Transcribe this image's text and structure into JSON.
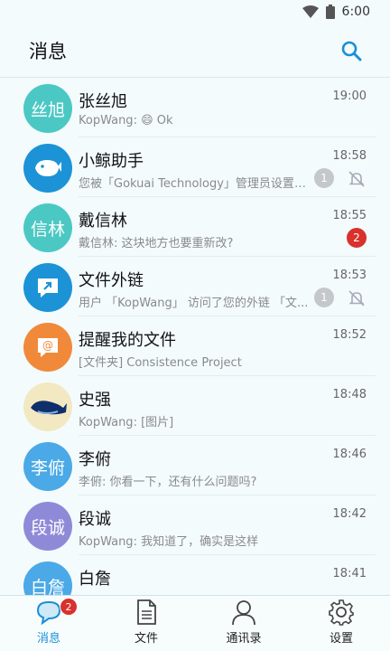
{
  "status_bar": {
    "time": "6:00"
  },
  "header": {
    "title": "消息"
  },
  "conversations": [
    {
      "avatar_text": "丝旭",
      "avatar_color": "#4cc8c4",
      "name": "张丝旭",
      "time": "19:00",
      "preview": "KopWang: 😄 Ok"
    },
    {
      "avatar_icon": "whale-icon",
      "avatar_color": "#1c93d6",
      "name": "小鲸助手",
      "time": "18:58",
      "preview": "您被「Gokuai Technology」管理员设置为...",
      "unread": "1",
      "muted": true
    },
    {
      "avatar_text": "信林",
      "avatar_color": "#4cc8c4",
      "name": "戴信林",
      "time": "18:55",
      "preview": "戴信林: 这块地方也要重新改?",
      "badge": "2"
    },
    {
      "avatar_icon": "link-icon",
      "avatar_color": "#1c93d6",
      "name": "文件外链",
      "time": "18:53",
      "preview": "用户 「KopWang」 访问了您的外链 「文...",
      "unread": "1",
      "muted": true
    },
    {
      "avatar_icon": "mention-icon",
      "avatar_color": "#f08a3a",
      "name": "提醒我的文件",
      "time": "18:52",
      "preview": "[文件夹] Consistence Project"
    },
    {
      "avatar_icon": "whale-photo-icon",
      "avatar_color": "#f2e9c2",
      "name": "史强",
      "time": "18:48",
      "preview": "KopWang: [图片]"
    },
    {
      "avatar_text": "李俯",
      "avatar_color": "#4aa9e6",
      "name": "李俯",
      "time": "18:46",
      "preview": "李俯: 你看一下，还有什么问题吗?"
    },
    {
      "avatar_text": "段诚",
      "avatar_color": "#8f8ad8",
      "name": "段诚",
      "time": "18:42",
      "preview": "KopWang: 我知道了，确实是这样"
    },
    {
      "avatar_text": "白詹",
      "avatar_color": "#4aa9e6",
      "name": "白詹",
      "time": "18:41",
      "preview": ""
    }
  ],
  "tabbar": {
    "messages": {
      "label": "消息",
      "badge": "2"
    },
    "files": {
      "label": "文件"
    },
    "contacts": {
      "label": "通讯录"
    },
    "settings": {
      "label": "设置"
    }
  },
  "colors": {
    "accent": "#1a8fd8",
    "badge_red": "#d9312b",
    "badge_gray": "#c4c8ca"
  }
}
